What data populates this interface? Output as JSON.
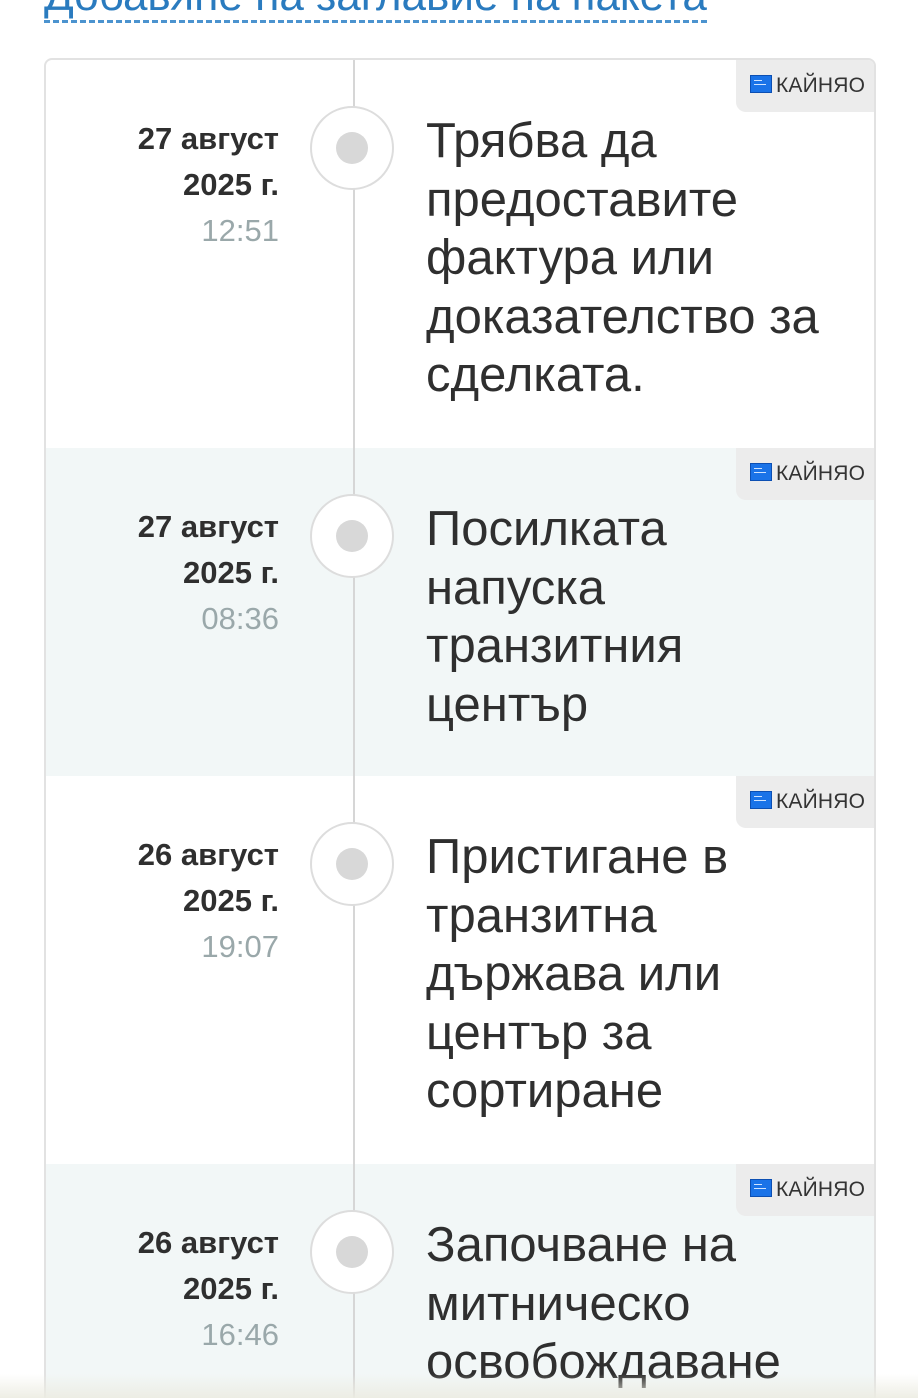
{
  "header": {
    "link_text": "Добавяне на заглавие на пакета"
  },
  "events": [
    {
      "date": "27 август",
      "year": "2025 г.",
      "time": "12:51",
      "description": "Трябва да предоставите фактура или доказателство за сделката.",
      "carrier": "КАЙНЯО"
    },
    {
      "date": "27 август",
      "year": "2025 г.",
      "time": "08:36",
      "description": "Посилката напуска транзитния център",
      "carrier": "КАЙНЯО"
    },
    {
      "date": "26 август",
      "year": "2025 г.",
      "time": "19:07",
      "description": "Пристигане в транзитна държава или център за сортиране",
      "carrier": "КАЙНЯО"
    },
    {
      "date": "26 август",
      "year": "2025 г.",
      "time": "16:46",
      "description": "Започване на митническо освобождаване",
      "carrier": "КАЙНЯО"
    }
  ],
  "colors": {
    "link": "#2a7bbf",
    "alt_row_bg": "#f2f7f7",
    "time_text": "#9aa8aa",
    "carrier_logo": "#1a73e8"
  }
}
